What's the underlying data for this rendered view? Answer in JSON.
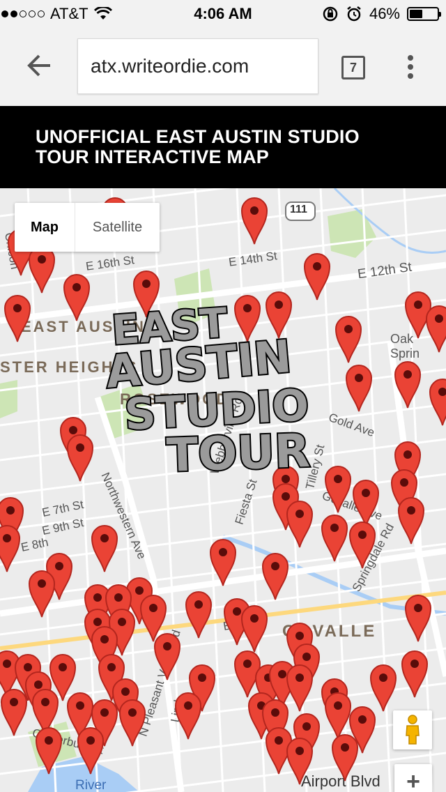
{
  "status_bar": {
    "carrier": "AT&T",
    "time": "4:06 AM",
    "battery": "46%"
  },
  "browser": {
    "url": "atx.writeordie.com",
    "tab_count": "7"
  },
  "page": {
    "title": "UNOFFICIAL EAST AUSTIN STUDIO TOUR INTERACTIVE MAP"
  },
  "map": {
    "type_control": {
      "map_label": "Map",
      "satellite_label": "Satellite",
      "selected": "Map"
    },
    "highway_shield": "111",
    "area_labels": [
      "EAST AUSTIN",
      "STER HEIGHTS",
      "ROSEWOOD",
      "GOVALLE"
    ],
    "street_labels": [
      "E 14th St",
      "E 12th St",
      "E 16th St",
      "Oak Sprin",
      "Webberville Rd",
      "Fiesta St",
      "Tillery St",
      "Northwestern Ave",
      "Springdale Rd",
      "E 7th St",
      "E 9th St",
      "E 8th",
      "N Pleasant Valley Rd",
      "Lind",
      "Canterbury St",
      "Airport Blvd",
      "River",
      "Chicon",
      "E 7th St",
      "Govalle Ave",
      "Gold Ave"
    ],
    "logo_text": [
      "EAST",
      "AUSTIN",
      "STUDIO",
      "TOUR"
    ],
    "marker_color": "#ea4335",
    "zoom_in_label": "+"
  }
}
